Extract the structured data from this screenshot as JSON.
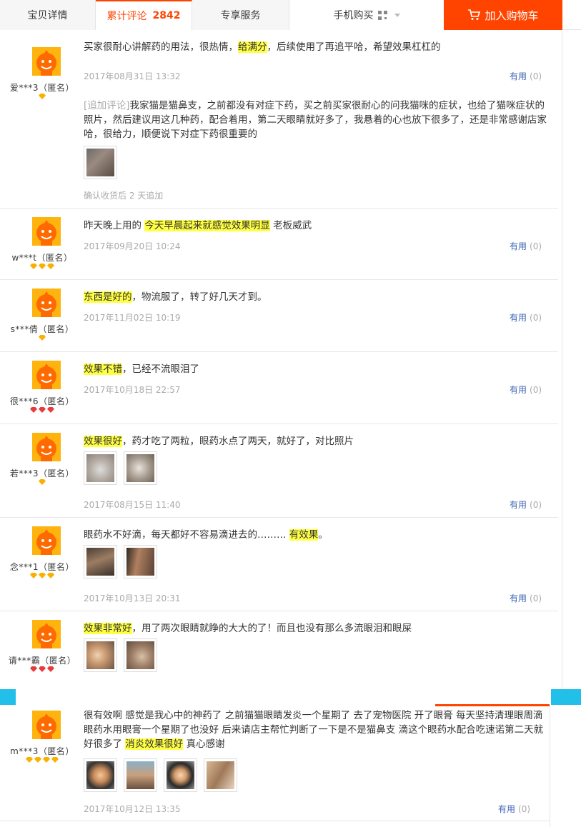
{
  "tabs": {
    "detail": "宝贝详情",
    "reviews": "累计评论",
    "reviews_count": "2842",
    "service": "专享服务",
    "mobile": "手机购买",
    "cart": "加入购物车"
  },
  "colors": {
    "accent": "#ff4400",
    "highlight": "#ffff44",
    "link": "#3c64b4",
    "band": "#22c0e8"
  },
  "useful_label": "有用",
  "reviews": [
    {
      "user": "爱***3（匿名）",
      "badge": "1 yellow",
      "segments": [
        {
          "t": "买家很耐心讲解药的用法，很热情，",
          "h": false
        },
        {
          "t": "给满分",
          "h": true
        },
        {
          "t": "，后续使用了再追平哈，希望效果杠杠的",
          "h": false
        }
      ],
      "date": "2017年08月31日 13:32",
      "useful": "(0)",
      "append_label": "[追加评论]",
      "append_text": "我家猫是猫鼻支，之前都没有对症下药，买之前买家很耐心的问我猫咪的症状，也给了猫咪症状的照片，然后建议用这几种药，配合着用，第二天眼睛就好多了，我悬着的心也放下很多了，还是非常感谢店家哈，很给力，顺便说下对症下药很重要的",
      "append_after": "确认收货后 2 天追加"
    },
    {
      "user": "w***t（匿名）",
      "badge": "3 yellow",
      "segments": [
        {
          "t": "昨天晚上用的 ",
          "h": false
        },
        {
          "t": "今天早晨起来就感觉效果明显",
          "h": true
        },
        {
          "t": " 老板威武",
          "h": false
        }
      ],
      "date": "2017年09月20日 10:24",
      "useful": "(0)"
    },
    {
      "user": "s***倩（匿名）",
      "badge": "1 yellow",
      "segments": [
        {
          "t": "东西是好的",
          "h": true
        },
        {
          "t": "，物流服了，转了好几天才到。",
          "h": false
        }
      ],
      "date": "2017年11月02日 10:19",
      "useful": "(0)"
    },
    {
      "user": "很***6（匿名）",
      "badge": "3 red",
      "segments": [
        {
          "t": "效果不错",
          "h": true
        },
        {
          "t": "，已经不流眼泪了",
          "h": false
        }
      ],
      "date": "2017年10月18日 22:57",
      "useful": "(0)"
    },
    {
      "user": "若***3（匿名）",
      "badge": "1 yellow",
      "segments": [
        {
          "t": "效果很好",
          "h": true
        },
        {
          "t": "，药才吃了两粒，眼药水点了两天，就好了，对比照片",
          "h": false
        }
      ],
      "date": "2017年08月15日 11:40",
      "useful": "(0)"
    },
    {
      "user": "念***1（匿名）",
      "badge": "3 yellow",
      "segments": [
        {
          "t": "眼药水不好滴，每天都好不容易滴进去的……… ",
          "h": false
        },
        {
          "t": "有效果",
          "h": true
        },
        {
          "t": "。",
          "h": false
        }
      ],
      "date": "2017年10月13日 20:31",
      "useful": "(0)"
    },
    {
      "user": "请***霸（匿名）",
      "badge": "3 red",
      "segments": [
        {
          "t": "效果非常好",
          "h": true
        },
        {
          "t": "，用了两次眼睛就睁的大大的了！而且也没有那么多流眼泪和眼屎",
          "h": false
        }
      ],
      "date": "",
      "useful": ""
    },
    {
      "user": "m***3（匿名）",
      "badge": "4 yellow",
      "segments": [
        {
          "t": "很有效啊 感觉是我心中的神药了 之前猫猫眼睛发炎一个星期了 去了宠物医院 开了眼膏 每天坚持清理眼周滴眼药水用眼膏一个星期了也没好 后来请店主帮忙判断了一下是不是猫鼻支 滴这个眼药水配合吃速诺第二天就好很多了 ",
          "h": false
        },
        {
          "t": "消炎效果很好",
          "h": true
        },
        {
          "t": " 真心感谢",
          "h": false
        }
      ],
      "date": "2017年10月12日 13:35",
      "useful": "(0)"
    }
  ]
}
